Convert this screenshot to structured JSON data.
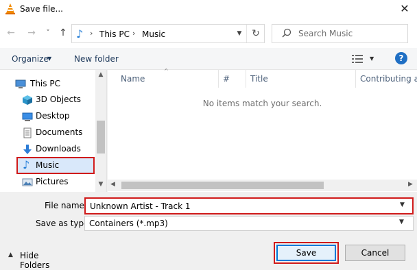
{
  "window": {
    "title": "Save file...",
    "close_glyph": "✕"
  },
  "nav": {
    "back_glyph": "←",
    "forward_glyph": "→",
    "recent_glyph": "˅",
    "up_glyph": "↑",
    "breadcrumb": [
      "This PC",
      "Music"
    ],
    "sep_glyph": "›",
    "search_placeholder": "Search Music"
  },
  "toolbar": {
    "organize_label": "Organize",
    "new_folder_label": "New folder",
    "help_label": "?"
  },
  "tree": {
    "items": [
      {
        "label": "This PC",
        "icon": "computer-icon"
      },
      {
        "label": "3D Objects",
        "icon": "cube-icon"
      },
      {
        "label": "Desktop",
        "icon": "desktop-icon"
      },
      {
        "label": "Documents",
        "icon": "document-icon"
      },
      {
        "label": "Downloads",
        "icon": "download-icon"
      },
      {
        "label": "Music",
        "icon": "music-icon",
        "selected": true
      },
      {
        "label": "Pictures",
        "icon": "picture-icon"
      }
    ]
  },
  "filelist": {
    "columns": [
      "Name",
      "#",
      "Title",
      "Contributing art"
    ],
    "empty_message": "No items match your search."
  },
  "form": {
    "filename_label": "File name:",
    "filename_value": "Unknown Artist - Track 1",
    "savetype_label": "Save as type:",
    "savetype_value": "Containers (*.mp3)"
  },
  "footer": {
    "hide_folders_label": "Hide Folders",
    "save_label": "Save",
    "cancel_label": "Cancel"
  },
  "colors": {
    "accent": "#0078d7",
    "highlight": "#d01a1a",
    "selected_bg": "#d9e8fa"
  }
}
